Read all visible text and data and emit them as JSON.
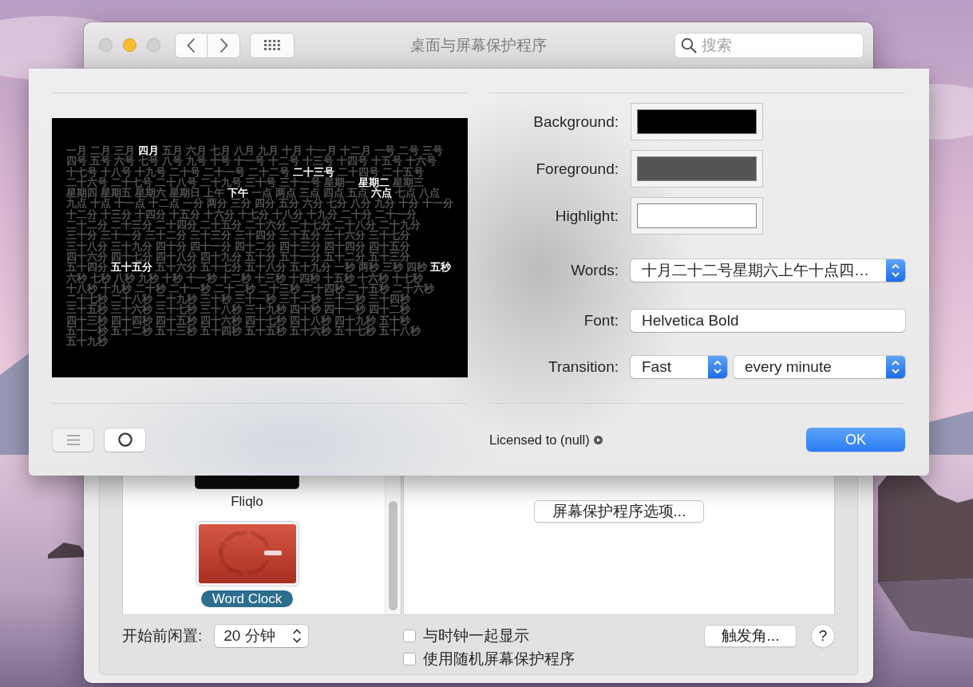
{
  "window": {
    "title": "桌面与屏幕保护程序",
    "search": {
      "placeholder": "搜索"
    }
  },
  "sheet": {
    "preview": {
      "lines": [
        {
          "words": [
            {
              "text": "一月",
              "highlighted": false
            },
            {
              "text": "二月",
              "highlighted": false
            },
            {
              "text": "三月",
              "highlighted": false
            },
            {
              "text": "四月",
              "highlighted": true
            },
            {
              "text": "五月",
              "highlighted": false
            },
            {
              "text": "六月",
              "highlighted": false
            },
            {
              "text": "七月",
              "highlighted": false
            },
            {
              "text": "八月",
              "highlighted": false
            },
            {
              "text": "九月",
              "highlighted": false
            },
            {
              "text": "十月",
              "highlighted": false
            },
            {
              "text": "十一月",
              "highlighted": false
            },
            {
              "text": "十二月",
              "highlighted": false
            },
            {
              "text": "一号",
              "highlighted": false
            },
            {
              "text": "二号",
              "highlighted": false
            },
            {
              "text": "三号",
              "highlighted": false
            }
          ]
        },
        {
          "words": [
            {
              "text": "四号",
              "highlighted": false
            },
            {
              "text": "五号",
              "highlighted": false
            },
            {
              "text": "六号",
              "highlighted": false
            },
            {
              "text": "七号",
              "highlighted": false
            },
            {
              "text": "八号",
              "highlighted": false
            },
            {
              "text": "九号",
              "highlighted": false
            },
            {
              "text": "十号",
              "highlighted": false
            },
            {
              "text": "十一号",
              "highlighted": false
            },
            {
              "text": "十二号",
              "highlighted": false
            },
            {
              "text": "十三号",
              "highlighted": false
            },
            {
              "text": "十四号",
              "highlighted": false
            },
            {
              "text": "十五号",
              "highlighted": false
            },
            {
              "text": "十六号",
              "highlighted": false
            }
          ]
        },
        {
          "words": [
            {
              "text": "十七号",
              "highlighted": false
            },
            {
              "text": "十八号",
              "highlighted": false
            },
            {
              "text": "十九号",
              "highlighted": false
            },
            {
              "text": "二十号",
              "highlighted": false
            },
            {
              "text": "二十一号",
              "highlighted": false
            },
            {
              "text": "二十二号",
              "highlighted": false
            },
            {
              "text": "二十三号",
              "highlighted": true
            },
            {
              "text": "二十四号",
              "highlighted": false
            },
            {
              "text": "二十五号",
              "highlighted": false
            }
          ]
        },
        {
          "words": [
            {
              "text": "二十六号",
              "highlighted": false
            },
            {
              "text": "二十七号",
              "highlighted": false
            },
            {
              "text": "二十八号",
              "highlighted": false
            },
            {
              "text": "二十九号",
              "highlighted": false
            },
            {
              "text": "三十号",
              "highlighted": false
            },
            {
              "text": "三十一号",
              "highlighted": false
            },
            {
              "text": "星期一",
              "highlighted": false
            },
            {
              "text": "星期二",
              "highlighted": true
            },
            {
              "text": "星期三",
              "highlighted": false
            }
          ]
        },
        {
          "words": [
            {
              "text": "星期四",
              "highlighted": false
            },
            {
              "text": "星期五",
              "highlighted": false
            },
            {
              "text": "星期六",
              "highlighted": false
            },
            {
              "text": "星期日",
              "highlighted": false
            },
            {
              "text": "上午",
              "highlighted": false
            },
            {
              "text": "下午",
              "highlighted": true
            },
            {
              "text": "一点",
              "highlighted": false
            },
            {
              "text": "两点",
              "highlighted": false
            },
            {
              "text": "三点",
              "highlighted": false
            },
            {
              "text": "四点",
              "highlighted": false
            },
            {
              "text": "五点",
              "highlighted": false
            },
            {
              "text": "六点",
              "highlighted": true
            },
            {
              "text": "七点",
              "highlighted": false
            },
            {
              "text": "八点",
              "highlighted": false
            }
          ]
        },
        {
          "words": [
            {
              "text": "九点",
              "highlighted": false
            },
            {
              "text": "十点",
              "highlighted": false
            },
            {
              "text": "十一点",
              "highlighted": false
            },
            {
              "text": "十二点",
              "highlighted": false
            },
            {
              "text": "一分",
              "highlighted": false
            },
            {
              "text": "两分",
              "highlighted": false
            },
            {
              "text": "三分",
              "highlighted": false
            },
            {
              "text": "四分",
              "highlighted": false
            },
            {
              "text": "五分",
              "highlighted": false
            },
            {
              "text": "六分",
              "highlighted": false
            },
            {
              "text": "七分",
              "highlighted": false
            },
            {
              "text": "八分",
              "highlighted": false
            },
            {
              "text": "九分",
              "highlighted": false
            },
            {
              "text": "十分",
              "highlighted": false
            },
            {
              "text": "十一分",
              "highlighted": false
            }
          ]
        },
        {
          "words": [
            {
              "text": "十二分",
              "highlighted": false
            },
            {
              "text": "十三分",
              "highlighted": false
            },
            {
              "text": "十四分",
              "highlighted": false
            },
            {
              "text": "十五分",
              "highlighted": false
            },
            {
              "text": "十六分",
              "highlighted": false
            },
            {
              "text": "十七分",
              "highlighted": false
            },
            {
              "text": "十八分",
              "highlighted": false
            },
            {
              "text": "十九分",
              "highlighted": false
            },
            {
              "text": "二十分",
              "highlighted": false
            },
            {
              "text": "二十一分",
              "highlighted": false
            }
          ]
        },
        {
          "words": [
            {
              "text": "二十二分",
              "highlighted": false
            },
            {
              "text": "二十三分",
              "highlighted": false
            },
            {
              "text": "二十四分",
              "highlighted": false
            },
            {
              "text": "二十五分",
              "highlighted": false
            },
            {
              "text": "二十六分",
              "highlighted": false
            },
            {
              "text": "二十七分",
              "highlighted": false
            },
            {
              "text": "二十八分",
              "highlighted": false
            },
            {
              "text": "二十九分",
              "highlighted": false
            }
          ]
        },
        {
          "words": [
            {
              "text": "三十分",
              "highlighted": false
            },
            {
              "text": "三十一分",
              "highlighted": false
            },
            {
              "text": "三十二分",
              "highlighted": false
            },
            {
              "text": "三十三分",
              "highlighted": false
            },
            {
              "text": "三十四分",
              "highlighted": false
            },
            {
              "text": "三十五分",
              "highlighted": false
            },
            {
              "text": "三十六分",
              "highlighted": false
            },
            {
              "text": "三十七分",
              "highlighted": false
            }
          ]
        },
        {
          "words": [
            {
              "text": "三十八分",
              "highlighted": false
            },
            {
              "text": "三十九分",
              "highlighted": false
            },
            {
              "text": "四十分",
              "highlighted": false
            },
            {
              "text": "四十一分",
              "highlighted": false
            },
            {
              "text": "四十二分",
              "highlighted": false
            },
            {
              "text": "四十三分",
              "highlighted": false
            },
            {
              "text": "四十四分",
              "highlighted": false
            },
            {
              "text": "四十五分",
              "highlighted": false
            }
          ]
        },
        {
          "words": [
            {
              "text": "四十六分",
              "highlighted": false
            },
            {
              "text": "四十七分",
              "highlighted": false
            },
            {
              "text": "四十八分",
              "highlighted": false
            },
            {
              "text": "四十九分",
              "highlighted": false
            },
            {
              "text": "五十分",
              "highlighted": false
            },
            {
              "text": "五十一分",
              "highlighted": false
            },
            {
              "text": "五十二分",
              "highlighted": false
            },
            {
              "text": "五十三分",
              "highlighted": false
            }
          ]
        },
        {
          "words": [
            {
              "text": "五十四分",
              "highlighted": false
            },
            {
              "text": "五十五分",
              "highlighted": true
            },
            {
              "text": "五十六分",
              "highlighted": false
            },
            {
              "text": "五十七分",
              "highlighted": false
            },
            {
              "text": "五十八分",
              "highlighted": false
            },
            {
              "text": "五十九分",
              "highlighted": false
            },
            {
              "text": "一秒",
              "highlighted": false
            },
            {
              "text": "两秒",
              "highlighted": false
            },
            {
              "text": "三秒",
              "highlighted": false
            },
            {
              "text": "四秒",
              "highlighted": false
            },
            {
              "text": "五秒",
              "highlighted": true
            }
          ]
        },
        {
          "words": [
            {
              "text": "六秒",
              "highlighted": false
            },
            {
              "text": "七秒",
              "highlighted": false
            },
            {
              "text": "八秒",
              "highlighted": false
            },
            {
              "text": "九秒",
              "highlighted": false
            },
            {
              "text": "十秒",
              "highlighted": false
            },
            {
              "text": "十一秒",
              "highlighted": false
            },
            {
              "text": "十二秒",
              "highlighted": false
            },
            {
              "text": "十三秒",
              "highlighted": false
            },
            {
              "text": "十四秒",
              "highlighted": false
            },
            {
              "text": "十五秒",
              "highlighted": false
            },
            {
              "text": "十六秒",
              "highlighted": false
            },
            {
              "text": "十七秒",
              "highlighted": false
            }
          ]
        },
        {
          "words": [
            {
              "text": "十八秒",
              "highlighted": false
            },
            {
              "text": "十九秒",
              "highlighted": false
            },
            {
              "text": "二十秒",
              "highlighted": false
            },
            {
              "text": "二十一秒",
              "highlighted": false
            },
            {
              "text": "二十二秒",
              "highlighted": false
            },
            {
              "text": "二十三秒",
              "highlighted": false
            },
            {
              "text": "二十四秒",
              "highlighted": false
            },
            {
              "text": "二十五秒",
              "highlighted": false
            },
            {
              "text": "二十六秒",
              "highlighted": false
            }
          ]
        },
        {
          "words": [
            {
              "text": "二十七秒",
              "highlighted": false
            },
            {
              "text": "二十八秒",
              "highlighted": false
            },
            {
              "text": "二十九秒",
              "highlighted": false
            },
            {
              "text": "三十秒",
              "highlighted": false
            },
            {
              "text": "三十一秒",
              "highlighted": false
            },
            {
              "text": "三十二秒",
              "highlighted": false
            },
            {
              "text": "三十三秒",
              "highlighted": false
            },
            {
              "text": "三十四秒",
              "highlighted": false
            }
          ]
        },
        {
          "words": [
            {
              "text": "三十五秒",
              "highlighted": false
            },
            {
              "text": "三十六秒",
              "highlighted": false
            },
            {
              "text": "三十七秒",
              "highlighted": false
            },
            {
              "text": "三十八秒",
              "highlighted": false
            },
            {
              "text": "三十九秒",
              "highlighted": false
            },
            {
              "text": "四十秒",
              "highlighted": false
            },
            {
              "text": "四十一秒",
              "highlighted": false
            },
            {
              "text": "四十二秒",
              "highlighted": false
            }
          ]
        },
        {
          "words": [
            {
              "text": "四十三秒",
              "highlighted": false
            },
            {
              "text": "四十四秒",
              "highlighted": false
            },
            {
              "text": "四十五秒",
              "highlighted": false
            },
            {
              "text": "四十六秒",
              "highlighted": false
            },
            {
              "text": "四十七秒",
              "highlighted": false
            },
            {
              "text": "四十八秒",
              "highlighted": false
            },
            {
              "text": "四十九秒",
              "highlighted": false
            },
            {
              "text": "五十秒",
              "highlighted": false
            }
          ]
        },
        {
          "words": [
            {
              "text": "五十一秒",
              "highlighted": false
            },
            {
              "text": "五十二秒",
              "highlighted": false
            },
            {
              "text": "五十三秒",
              "highlighted": false
            },
            {
              "text": "五十四秒",
              "highlighted": false
            },
            {
              "text": "五十五秒",
              "highlighted": false
            },
            {
              "text": "五十六秒",
              "highlighted": false
            },
            {
              "text": "五十七秒",
              "highlighted": false
            },
            {
              "text": "五十八秒",
              "highlighted": false
            }
          ]
        },
        {
          "words": [
            {
              "text": "五十九秒",
              "highlighted": false
            }
          ]
        }
      ]
    },
    "colors": [
      {
        "label": "Background:",
        "color": "#000000"
      },
      {
        "label": "Foreground:",
        "color": "#545454"
      },
      {
        "label": "Highlight:",
        "color": "#ffffff"
      }
    ],
    "words": {
      "label": "Words:",
      "value": "十月二十二号星期六上午十点四…"
    },
    "font": {
      "label": "Font:",
      "value": "Helvetica Bold"
    },
    "transition": {
      "label": "Transition:",
      "speed": "Fast",
      "interval": "every minute"
    },
    "tools": [
      {
        "kind": "list",
        "disabled": true
      },
      {
        "kind": "circle",
        "disabled": false
      }
    ],
    "license": "Licensed to (null)",
    "ok": "OK"
  },
  "screensavers": [
    {
      "name": "Fliqlo",
      "kind": "dark",
      "selected": false
    },
    {
      "name": "Word Clock",
      "kind": "red",
      "selected": true
    }
  ],
  "options_button": "屏幕保护程序选项...",
  "idle": {
    "label": "开始前闲置:",
    "value": "20 分钟"
  },
  "checkboxes": [
    {
      "label": "与时钟一起显示",
      "checked": false
    },
    {
      "label": "使用随机屏幕保护程序",
      "checked": false
    }
  ],
  "hot_corners_button": "触发角...",
  "help_button": "?"
}
